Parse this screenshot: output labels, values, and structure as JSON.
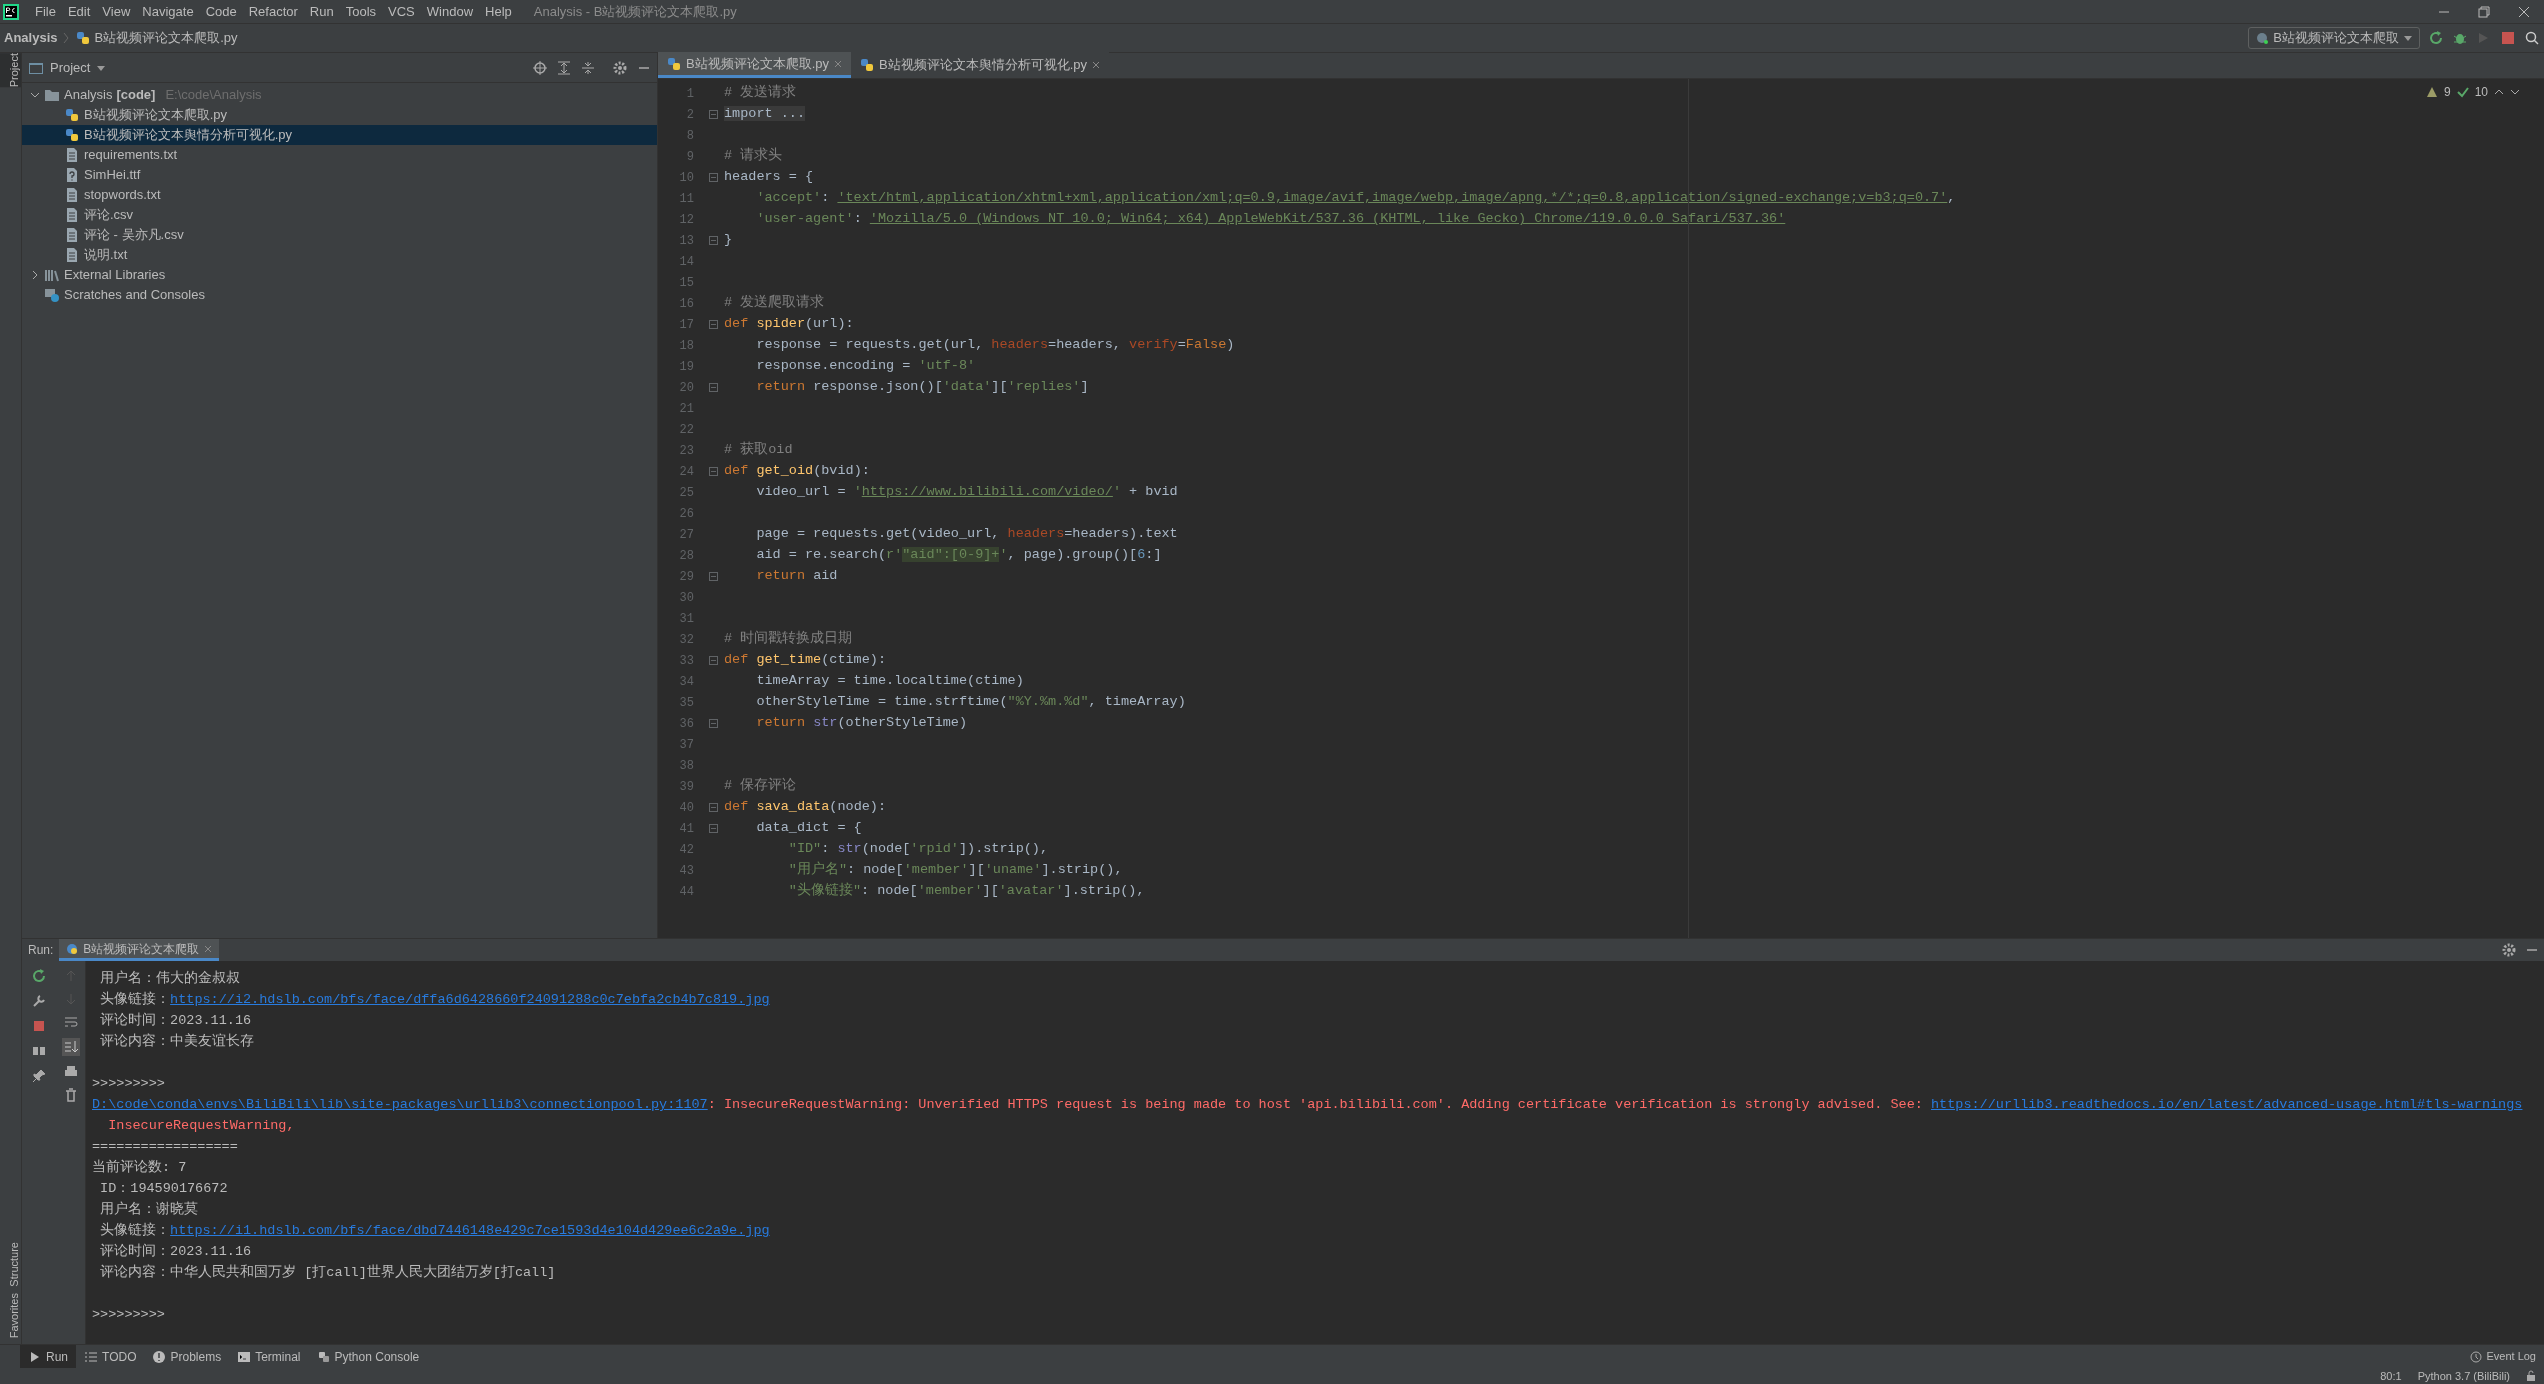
{
  "menu_bar": {
    "items": [
      "File",
      "Edit",
      "View",
      "Navigate",
      "Code",
      "Refactor",
      "Run",
      "Tools",
      "VCS",
      "Window",
      "Help"
    ],
    "title": "Analysis - B站视频评论文本爬取.py"
  },
  "nav_bar": {
    "project": "Analysis",
    "file": "B站视频评论文本爬取.py",
    "run_config": "B站视频评论文本爬取"
  },
  "side_tabs": {
    "top": [
      {
        "label": "Project",
        "selected": true
      }
    ],
    "bottom": [
      {
        "label": "Structure",
        "selected": false
      },
      {
        "label": "Favorites",
        "selected": false
      }
    ]
  },
  "project_panel": {
    "title": "Project",
    "tree": [
      {
        "label": "Analysis",
        "tag": "[code]",
        "path": "E:\\code\\Analysis",
        "kind": "folder",
        "expanded": true,
        "selected": false,
        "children": [
          {
            "label": "B站视频评论文本爬取.py",
            "kind": "python",
            "selected": false
          },
          {
            "label": "B站视频评论文本舆情分析可视化.py",
            "kind": "python",
            "selected": true
          },
          {
            "label": "requirements.txt",
            "kind": "text",
            "selected": false
          },
          {
            "label": "SimHei.ttf",
            "kind": "unknown",
            "selected": false
          },
          {
            "label": "stopwords.txt",
            "kind": "text",
            "selected": false
          },
          {
            "label": "评论.csv",
            "kind": "text",
            "selected": false
          },
          {
            "label": "评论 - 吴亦凡.csv",
            "kind": "text",
            "selected": false
          },
          {
            "label": "说明.txt",
            "kind": "text",
            "selected": false
          }
        ]
      },
      {
        "label": "External Libraries",
        "kind": "library",
        "expanded": false,
        "selected": false
      },
      {
        "label": "Scratches and Consoles",
        "kind": "scratches",
        "selected": false
      }
    ]
  },
  "editor": {
    "tabs": [
      {
        "label": "B站视频评论文本爬取.py",
        "selected": true
      },
      {
        "label": "B站视频评论文本舆情分析可视化.py",
        "selected": false
      }
    ],
    "inspections": {
      "warnings": "9",
      "ok": "10"
    },
    "lines": [
      {
        "num": "1",
        "segments": [
          {
            "kind": "comment",
            "text": "# 发送请求"
          }
        ]
      },
      {
        "num": "2",
        "fold": true,
        "segments": [
          {
            "kind": "folded",
            "text": "import ..."
          }
        ]
      },
      {
        "num": "8"
      },
      {
        "num": "9",
        "segments": [
          {
            "kind": "comment",
            "text": "# 请求头"
          }
        ]
      },
      {
        "num": "10",
        "fold": true,
        "segments": [
          {
            "kind": "plain",
            "text": "headers = {"
          }
        ]
      },
      {
        "num": "11",
        "segments": [
          {
            "kind": "string",
            "text": "    'accept'"
          },
          {
            "kind": "plain",
            "text": ": "
          },
          {
            "kind": "url",
            "text": "'text/html,application/xhtml+xml,application/xml;q=0.9,image/avif,image/webp,image/apng,*/*;q=0.8,application/signed-exchange;v=b3;q=0.7'"
          },
          {
            "kind": "plain",
            "text": ","
          }
        ]
      },
      {
        "num": "12",
        "segments": [
          {
            "kind": "string",
            "text": "    'user-agent'"
          },
          {
            "kind": "plain",
            "text": ": "
          },
          {
            "kind": "url",
            "text": "'Mozilla/5.0 (Windows NT 10.0; Win64; x64) AppleWebKit/537.36 (KHTML, like Gecko) Chrome/119.0.0.0 Safari/537.36'"
          }
        ]
      },
      {
        "num": "13",
        "fold": true,
        "segments": [
          {
            "kind": "plain",
            "text": "}"
          }
        ]
      },
      {
        "num": "14"
      },
      {
        "num": "15"
      },
      {
        "num": "16",
        "segments": [
          {
            "kind": "comment",
            "text": "# 发送爬取请求"
          }
        ]
      },
      {
        "num": "17",
        "fold": true,
        "segments": [
          {
            "kind": "keyword",
            "text": "def "
          },
          {
            "kind": "func",
            "text": "spider"
          },
          {
            "kind": "plain",
            "text": "(url):"
          }
        ]
      },
      {
        "num": "18",
        "segments": [
          {
            "kind": "plain",
            "text": "    response = requests.get(url, "
          },
          {
            "kind": "kwarg",
            "text": "headers"
          },
          {
            "kind": "plain",
            "text": "=headers, "
          },
          {
            "kind": "kwarg",
            "text": "verify"
          },
          {
            "kind": "plain",
            "text": "="
          },
          {
            "kind": "keyword",
            "text": "False"
          },
          {
            "kind": "plain",
            "text": ")"
          }
        ]
      },
      {
        "num": "19",
        "segments": [
          {
            "kind": "plain",
            "text": "    response.encoding = "
          },
          {
            "kind": "string",
            "text": "'utf-8'"
          }
        ]
      },
      {
        "num": "20",
        "fold": true,
        "segments": [
          {
            "kind": "keyword",
            "text": "    return "
          },
          {
            "kind": "plain",
            "text": "response.json()["
          },
          {
            "kind": "string",
            "text": "'data'"
          },
          {
            "kind": "plain",
            "text": "]["
          },
          {
            "kind": "string",
            "text": "'replies'"
          },
          {
            "kind": "plain",
            "text": "]"
          }
        ]
      },
      {
        "num": "21"
      },
      {
        "num": "22"
      },
      {
        "num": "23",
        "segments": [
          {
            "kind": "comment",
            "text": "# 获取oid"
          }
        ]
      },
      {
        "num": "24",
        "fold": true,
        "segments": [
          {
            "kind": "keyword",
            "text": "def "
          },
          {
            "kind": "func",
            "text": "get_oid"
          },
          {
            "kind": "plain",
            "text": "(bvid):"
          }
        ]
      },
      {
        "num": "25",
        "segments": [
          {
            "kind": "plain",
            "text": "    video_url = "
          },
          {
            "kind": "string",
            "text": "'"
          },
          {
            "kind": "url",
            "text": "https://www.bilibili.com/video/"
          },
          {
            "kind": "string",
            "text": "'"
          },
          {
            "kind": "plain",
            "text": " + bvid"
          }
        ]
      },
      {
        "num": "26"
      },
      {
        "num": "27",
        "segments": [
          {
            "kind": "plain",
            "text": "    page = requests.get(video_url, "
          },
          {
            "kind": "kwarg",
            "text": "headers"
          },
          {
            "kind": "plain",
            "text": "=headers).text"
          }
        ]
      },
      {
        "num": "28",
        "segments": [
          {
            "kind": "plain",
            "text": "    aid = re.search("
          },
          {
            "kind": "string",
            "text": "r'"
          },
          {
            "kind": "regex",
            "text": "\"aid\":[0-9]+"
          },
          {
            "kind": "string",
            "text": "'"
          },
          {
            "kind": "plain",
            "text": ", page).group()["
          },
          {
            "kind": "number",
            "text": "6"
          },
          {
            "kind": "plain",
            "text": ":]"
          }
        ]
      },
      {
        "num": "29",
        "fold": true,
        "segments": [
          {
            "kind": "keyword",
            "text": "    return "
          },
          {
            "kind": "plain",
            "text": "aid"
          }
        ]
      },
      {
        "num": "30"
      },
      {
        "num": "31"
      },
      {
        "num": "32",
        "segments": [
          {
            "kind": "comment",
            "text": "# 时间戳转换成日期"
          }
        ]
      },
      {
        "num": "33",
        "fold": true,
        "segments": [
          {
            "kind": "keyword",
            "text": "def "
          },
          {
            "kind": "func",
            "text": "get_time"
          },
          {
            "kind": "plain",
            "text": "(ctime):"
          }
        ]
      },
      {
        "num": "34",
        "segments": [
          {
            "kind": "plain",
            "text": "    timeArray = time.localtime(ctime)"
          }
        ]
      },
      {
        "num": "35",
        "segments": [
          {
            "kind": "plain",
            "text": "    otherStyleTime = time.strftime("
          },
          {
            "kind": "string",
            "text": "\"%Y.%m.%d\""
          },
          {
            "kind": "plain",
            "text": ", timeArray)"
          }
        ]
      },
      {
        "num": "36",
        "fold": true,
        "segments": [
          {
            "kind": "keyword",
            "text": "    return "
          },
          {
            "kind": "builtin",
            "text": "str"
          },
          {
            "kind": "plain",
            "text": "(otherStyleTime)"
          }
        ]
      },
      {
        "num": "37"
      },
      {
        "num": "38"
      },
      {
        "num": "39",
        "segments": [
          {
            "kind": "comment",
            "text": "# 保存评论"
          }
        ]
      },
      {
        "num": "40",
        "fold": true,
        "segments": [
          {
            "kind": "keyword",
            "text": "def "
          },
          {
            "kind": "func",
            "text": "sava_data"
          },
          {
            "kind": "plain",
            "text": "(node):"
          }
        ]
      },
      {
        "num": "41",
        "fold": true,
        "segments": [
          {
            "kind": "plain",
            "text": "    data_dict = {"
          }
        ]
      },
      {
        "num": "42",
        "segments": [
          {
            "kind": "string",
            "text": "        \"ID\""
          },
          {
            "kind": "plain",
            "text": ": "
          },
          {
            "kind": "builtin",
            "text": "str"
          },
          {
            "kind": "plain",
            "text": "(node["
          },
          {
            "kind": "string",
            "text": "'rpid'"
          },
          {
            "kind": "plain",
            "text": "]).strip(),"
          }
        ]
      },
      {
        "num": "43",
        "segments": [
          {
            "kind": "string",
            "text": "        \"用户名\""
          },
          {
            "kind": "plain",
            "text": ": node["
          },
          {
            "kind": "string",
            "text": "'member'"
          },
          {
            "kind": "plain",
            "text": "]["
          },
          {
            "kind": "string",
            "text": "'uname'"
          },
          {
            "kind": "plain",
            "text": "].strip(),"
          }
        ]
      },
      {
        "num": "44",
        "segments": [
          {
            "kind": "string",
            "text": "        \"头像链接\""
          },
          {
            "kind": "plain",
            "text": ": node["
          },
          {
            "kind": "string",
            "text": "'member'"
          },
          {
            "kind": "plain",
            "text": "]["
          },
          {
            "kind": "string",
            "text": "'avatar'"
          },
          {
            "kind": "plain",
            "text": "].strip(),"
          }
        ]
      }
    ]
  },
  "run_panel": {
    "label": "Run:",
    "tab": "B站视频评论文本爬取",
    "output_blocks": [
      [
        [
          {
            "kind": "plain",
            "text": " 用户名：伟大的金叔叔"
          }
        ],
        [
          {
            "kind": "plain",
            "text": " 头像链接："
          },
          {
            "kind": "link",
            "text": "https://i2.hdslb.com/bfs/face/dffa6d6428660f24091288c0c7ebfa2cb4b7c819.jpg"
          }
        ],
        [
          {
            "kind": "plain",
            "text": " 评论时间：2023.11.16"
          }
        ],
        [
          {
            "kind": "plain",
            "text": " 评论内容：中美友谊长存"
          }
        ]
      ],
      [
        [
          {
            "kind": "plain",
            "text": ">>>>>>>>>"
          }
        ],
        [
          {
            "kind": "link",
            "text": "D:\\code\\conda\\envs\\BiliBili\\lib\\site-packages\\urllib3\\connectionpool.py:1107"
          },
          {
            "kind": "error",
            "text": ": InsecureRequestWarning: Unverified HTTPS request is being made to host 'api.bilibili.com'. Adding certificate verification is strongly advised. See: "
          },
          {
            "kind": "link",
            "text": "https://urllib3.readthedocs.io/en/latest/advanced-usage.html#tls-warnings"
          }
        ],
        [
          {
            "kind": "error",
            "text": "  InsecureRequestWarning,"
          }
        ],
        [
          {
            "kind": "plain",
            "text": "=================="
          }
        ],
        [
          {
            "kind": "plain",
            "text": "当前评论数: 7"
          }
        ],
        [
          {
            "kind": "plain",
            "text": " ID：194590176672"
          }
        ],
        [
          {
            "kind": "plain",
            "text": " 用户名：谢晓莫"
          }
        ],
        [
          {
            "kind": "plain",
            "text": " 头像链接："
          },
          {
            "kind": "link",
            "text": "https://i1.hdslb.com/bfs/face/dbd7446148e429c7ce1593d4e104d429ee6c2a9e.jpg"
          }
        ],
        [
          {
            "kind": "plain",
            "text": " 评论时间：2023.11.16"
          }
        ],
        [
          {
            "kind": "plain",
            "text": " 评论内容：中华人民共和国万岁 [打call]世界人民大团结万岁[打call]"
          }
        ]
      ],
      [
        [
          {
            "kind": "plain",
            "text": ">>>>>>>>>"
          }
        ]
      ]
    ]
  },
  "tool_bar": {
    "items": [
      {
        "label": "Run",
        "kind": "run",
        "selected": true
      },
      {
        "label": "TODO",
        "kind": "todo",
        "selected": false
      },
      {
        "label": "Problems",
        "kind": "problems",
        "selected": false
      },
      {
        "label": "Terminal",
        "kind": "terminal",
        "selected": false
      },
      {
        "label": "Python Console",
        "kind": "console",
        "selected": false
      }
    ],
    "event_log": "Event Log"
  },
  "status_bar": {
    "position": "80:1",
    "interpreter": "Python 3.7 (BiliBili)"
  }
}
